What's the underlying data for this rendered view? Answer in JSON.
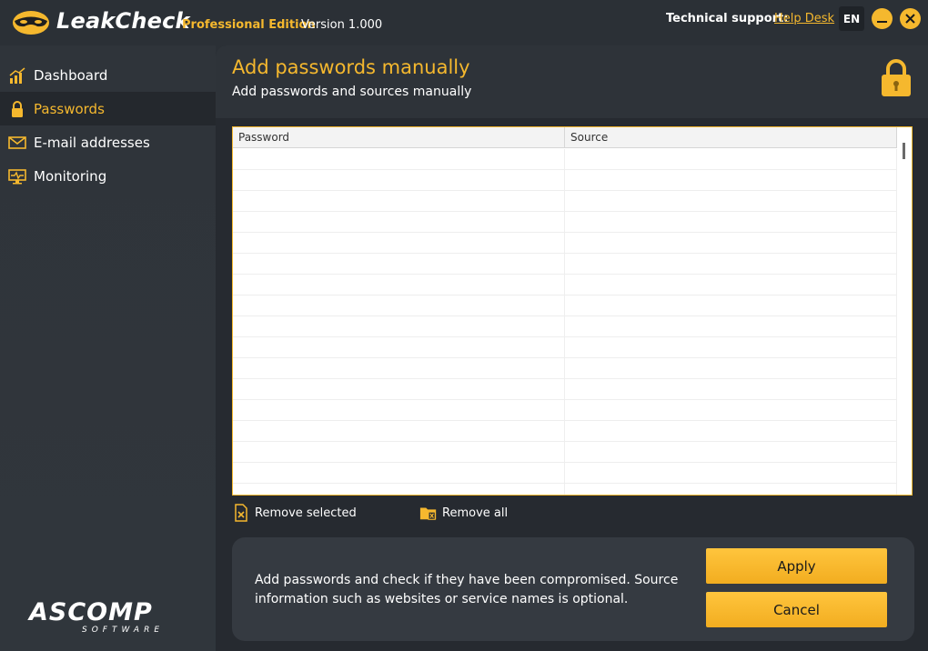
{
  "app": {
    "name": "LeakCheck",
    "edition": "Professional Edition",
    "version": "Version 1.000"
  },
  "titlebar": {
    "support_label": "Technical support:",
    "helpdesk_link": "Help Desk",
    "language": "EN"
  },
  "sidebar": {
    "items": [
      {
        "label": "Dashboard",
        "icon": "bar-chart-icon",
        "active": false
      },
      {
        "label": "Passwords",
        "icon": "lock-icon",
        "active": true
      },
      {
        "label": "E-mail addresses",
        "icon": "envelope-icon",
        "active": false
      },
      {
        "label": "Monitoring",
        "icon": "monitor-icon",
        "active": false
      }
    ],
    "brand_top": "ASCOMP",
    "brand_bottom": "SOFTWARE"
  },
  "main": {
    "title": "Add passwords manually",
    "subtitle": "Add passwords and sources manually"
  },
  "table": {
    "columns": [
      "Password",
      "Source"
    ],
    "rows": [
      [
        "",
        ""
      ],
      [
        "",
        ""
      ],
      [
        "",
        ""
      ],
      [
        "",
        ""
      ],
      [
        "",
        ""
      ],
      [
        "",
        ""
      ],
      [
        "",
        ""
      ],
      [
        "",
        ""
      ],
      [
        "",
        ""
      ],
      [
        "",
        ""
      ],
      [
        "",
        ""
      ],
      [
        "",
        ""
      ],
      [
        "",
        ""
      ],
      [
        "",
        ""
      ],
      [
        "",
        ""
      ],
      [
        "",
        ""
      ],
      [
        "",
        ""
      ]
    ]
  },
  "actions": {
    "remove_selected": "Remove selected",
    "remove_all": "Remove all"
  },
  "info": {
    "text": "Add passwords and check if they have been compromised. Source information such as websites or service names is optional.",
    "apply_label": "Apply",
    "cancel_label": "Cancel"
  },
  "colors": {
    "accent": "#f5b82e",
    "background": "#2b3036",
    "panel": "#262a30"
  }
}
